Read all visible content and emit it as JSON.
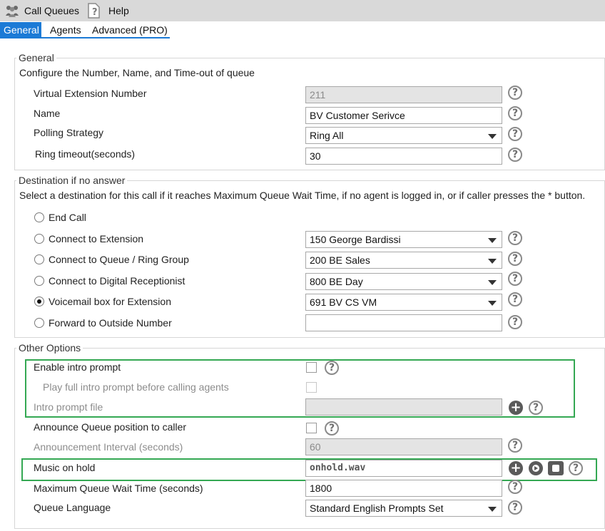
{
  "toolbar": {
    "call_queues": "Call Queues",
    "help": "Help"
  },
  "tabs": [
    {
      "label": "General"
    },
    {
      "label": "Agents"
    },
    {
      "label": "Advanced (PRO)"
    }
  ],
  "general": {
    "legend": "General",
    "description": "Configure the Number, Name, and Time-out of queue",
    "virtual_ext_label": "Virtual Extension Number",
    "virtual_ext_value": "211",
    "name_label": "Name",
    "name_value": "BV Customer Serivce",
    "polling_label": "Polling Strategy",
    "polling_value": "Ring All",
    "ring_timeout_label": "Ring timeout(seconds)",
    "ring_timeout_value": "30"
  },
  "destination": {
    "legend": "Destination if no answer",
    "description": "Select a destination for this call if it reaches Maximum Queue Wait Time, if no agent is logged in, or if caller presses the * button.",
    "options": [
      {
        "label": "End Call",
        "value": ""
      },
      {
        "label": "Connect to Extension",
        "value": "150 George Bardissi"
      },
      {
        "label": "Connect to Queue / Ring Group",
        "value": "200 BE Sales"
      },
      {
        "label": "Connect to Digital Receptionist",
        "value": "800 BE Day"
      },
      {
        "label": "Voicemail box for Extension",
        "value": "691 BV CS VM"
      },
      {
        "label": "Forward to Outside Number",
        "value": ""
      }
    ],
    "selected": "Voicemail box for Extension"
  },
  "other": {
    "legend": "Other Options",
    "enable_intro_label": "Enable intro prompt",
    "play_full_label": "Play full intro prompt before calling agents",
    "intro_file_label": "Intro prompt file",
    "announce_pos_label": "Announce Queue position to caller",
    "announce_interval_label": "Announcement Interval (seconds)",
    "announce_interval_value": "60",
    "music_label": "Music on hold",
    "music_value": "onhold.wav",
    "max_wait_label": "Maximum Queue Wait Time (seconds)",
    "max_wait_value": "1800",
    "language_label": "Queue Language",
    "language_value": "Standard English Prompts Set"
  },
  "icons": {
    "help": "?",
    "add": "+"
  },
  "colors": {
    "tab_active": "#1b7ad6",
    "highlight_box": "#34a853",
    "toolbar_bg": "#d9d9d9"
  }
}
